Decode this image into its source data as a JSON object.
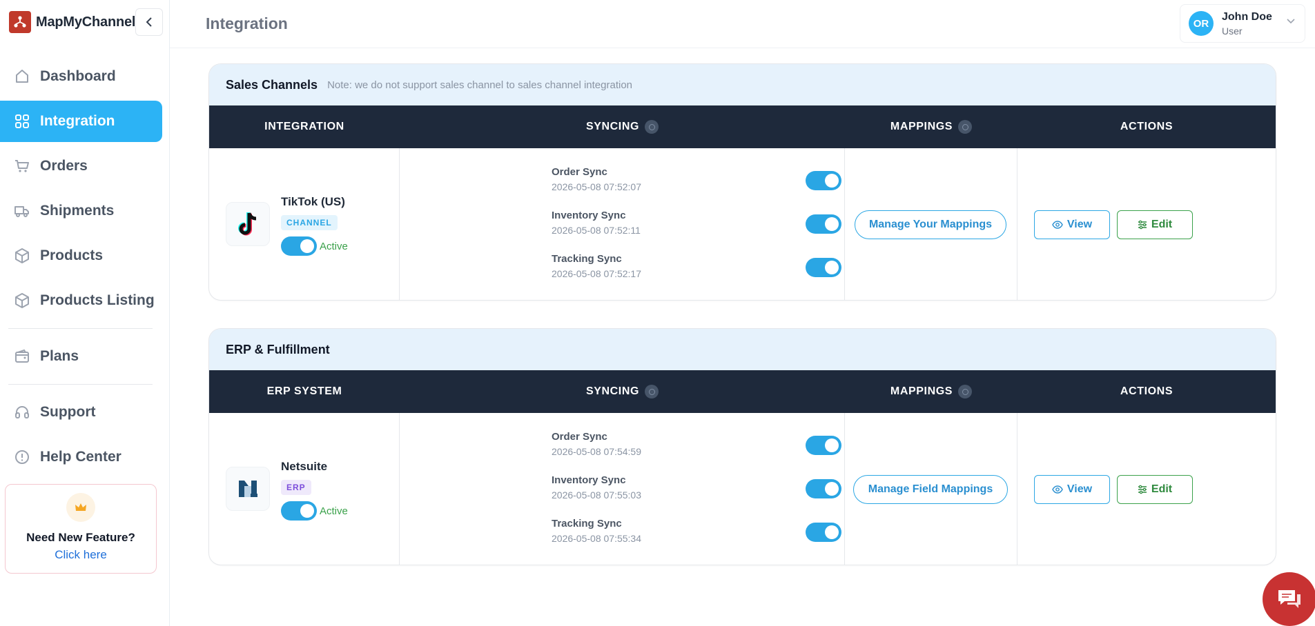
{
  "brand": {
    "name": "MapMyChannel",
    "accent": "#c0392b"
  },
  "sidebar": {
    "items": [
      {
        "label": "Dashboard",
        "icon": "home-icon",
        "active": false
      },
      {
        "label": "Integration",
        "icon": "grid-icon",
        "active": true
      },
      {
        "label": "Orders",
        "icon": "cart-icon",
        "active": false
      },
      {
        "label": "Shipments",
        "icon": "truck-icon",
        "active": false
      },
      {
        "label": "Products",
        "icon": "box-icon",
        "active": false
      },
      {
        "label": "Products Listing",
        "icon": "box-icon",
        "active": false
      },
      {
        "label": "Plans",
        "icon": "wallet-icon",
        "active": false
      },
      {
        "label": "Support",
        "icon": "headset-icon",
        "active": false
      },
      {
        "label": "Help Center",
        "icon": "alert-circle-icon",
        "active": false
      }
    ],
    "feature": {
      "title": "Need New Feature?",
      "link": "Click here",
      "icon": "crown-icon"
    }
  },
  "header": {
    "title": "Integration",
    "user": {
      "initials": "OR",
      "name": "John Doe",
      "role": "User"
    }
  },
  "sales_channels": {
    "title": "Sales Channels",
    "note": "Note: we do not support sales channel to sales channel integration",
    "columns": [
      "INTEGRATION",
      "SYNCING",
      "MAPPINGS",
      "ACTIONS"
    ],
    "row": {
      "name": "TikTok (US)",
      "badge": "CHANNEL",
      "status": "Active",
      "syncs": [
        {
          "name": "Order Sync",
          "time": "2026-05-08 07:52:07"
        },
        {
          "name": "Inventory Sync",
          "time": "2026-05-08 07:52:11"
        },
        {
          "name": "Tracking Sync",
          "time": "2026-05-08 07:52:17"
        }
      ],
      "mapping_label": "Manage Your Mappings",
      "view_label": "View",
      "edit_label": "Edit"
    }
  },
  "erp": {
    "title": "ERP & Fulfillment",
    "columns": [
      "ERP SYSTEM",
      "SYNCING",
      "MAPPINGS",
      "ACTIONS"
    ],
    "row": {
      "name": "Netsuite",
      "badge": "ERP",
      "status": "Active",
      "syncs": [
        {
          "name": "Order Sync",
          "time": "2026-05-08 07:54:59"
        },
        {
          "name": "Inventory Sync",
          "time": "2026-05-08 07:55:03"
        },
        {
          "name": "Tracking Sync",
          "time": "2026-05-08 07:55:34"
        }
      ],
      "mapping_label": "Manage Field Mappings",
      "view_label": "View",
      "edit_label": "Edit"
    }
  },
  "colors": {
    "primary": "#2cb3f5",
    "header_dark": "#1e293b",
    "success": "#3aa14a",
    "chat": "#c83232"
  },
  "chat": {
    "icon": "chat-icon"
  }
}
